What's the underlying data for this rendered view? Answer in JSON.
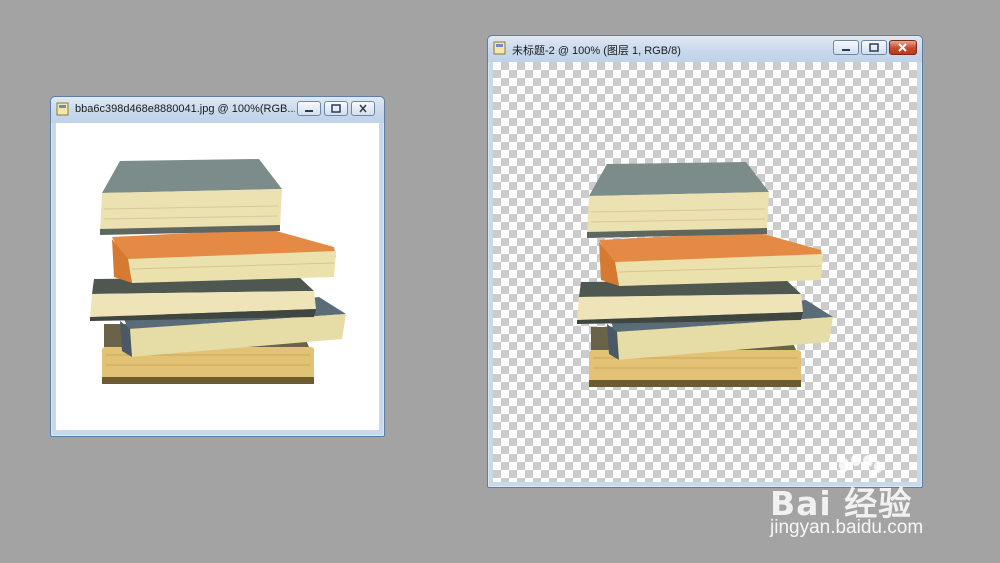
{
  "windows": [
    {
      "title": "bba6c398d468e8880041.jpg @ 100%(RGB..."
    },
    {
      "title": "未标题-2 @ 100% (图层 1, RGB/8)"
    }
  ],
  "controls": {
    "minimize_icon": "minimize-icon",
    "maximize_icon": "maximize-icon",
    "close_icon": "close-icon"
  },
  "watermark": {
    "logo_text": "Bai 经验",
    "url": "jingyan.baidu.com"
  },
  "colors": {
    "desktop": "#a3a3a3",
    "checker": "#cccccc",
    "close_button": "#c7492c"
  }
}
